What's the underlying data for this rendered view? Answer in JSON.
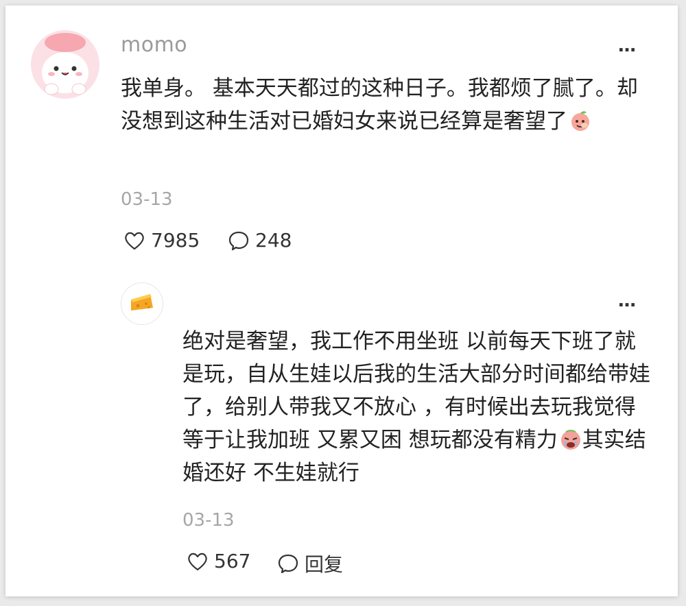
{
  "comment": {
    "username": "momo",
    "text": "我单身。 基本天天都过的这种日子。我都烦了腻了。却没想到这种生活对已婚妇女来说已经算是奢望了",
    "date": "03-13",
    "likes": "7985",
    "comments": "248",
    "more_icon": "…"
  },
  "reply": {
    "text_part1": "绝对是奢望，我工作不用坐班 以前每天下班了就是玩，自从生娃以后我的生活大部分时间都给带娃了，给别人带我又不放心 ，有时候出去玩我觉得等于让我加班 又累又困 想玩都没有精力",
    "text_part2": "其实结婚还好 不生娃就行",
    "date": "03-13",
    "likes": "567",
    "reply_label": "回复",
    "more_icon": "…"
  }
}
